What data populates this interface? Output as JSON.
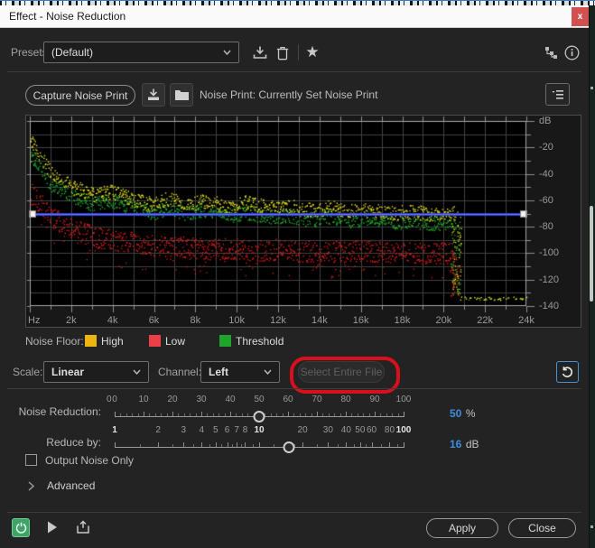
{
  "window": {
    "title": "Effect - Noise Reduction",
    "close_label": "x"
  },
  "presets": {
    "label": "Presets:",
    "value": "(Default)"
  },
  "noise_print": {
    "capture_button": "Capture Noise Print",
    "status_label": "Noise Print:",
    "status_value": "Currently Set Noise Print"
  },
  "chart_data": {
    "type": "scatter",
    "x_axis": {
      "tick_labels": [
        "Hz",
        "2k",
        "4k",
        "6k",
        "8k",
        "10k",
        "12k",
        "14k",
        "16k",
        "18k",
        "20k",
        "22k",
        "24k"
      ],
      "min_khz": 0,
      "max_khz": 24,
      "gridline_every_khz": 1
    },
    "y_axis": {
      "tick_labels": [
        "dB",
        "-20",
        "-40",
        "-60",
        "-80",
        "-100",
        "-120",
        "-140"
      ],
      "min_db": -140,
      "max_db": 0,
      "gridline_every_db": 10
    },
    "threshold_line": {
      "db": -70,
      "color": "#3040dd",
      "highlight": "#6a79ef",
      "handle_color": "#f2f2f2"
    },
    "grid_color": "#424242",
    "frame_color": "#a6a6a6",
    "plot_bg": "#000000",
    "series": [
      {
        "name": "Low",
        "color": "#e01d1d",
        "seed": 23,
        "spread_db": 16,
        "cutoff_khz": 20.45,
        "residual": {
          "db": -134,
          "density": 0
        },
        "envelope": [
          [
            0,
            -52
          ],
          [
            0.5,
            -60
          ],
          [
            1,
            -70
          ],
          [
            2,
            -79
          ],
          [
            3,
            -85
          ],
          [
            4,
            -88
          ],
          [
            5,
            -90
          ],
          [
            6,
            -92
          ],
          [
            7,
            -93
          ],
          [
            8,
            -94
          ],
          [
            9,
            -95
          ],
          [
            10,
            -94
          ],
          [
            11,
            -96
          ],
          [
            12,
            -95
          ],
          [
            13,
            -97
          ],
          [
            14,
            -96
          ],
          [
            15,
            -97
          ],
          [
            16,
            -96
          ],
          [
            17,
            -97
          ],
          [
            18,
            -97
          ],
          [
            19,
            -98
          ],
          [
            20.45,
            -98
          ]
        ]
      },
      {
        "name": "Threshold",
        "color": "#21b52d",
        "seed": 13,
        "spread_db": 11,
        "cutoff_khz": 20.5,
        "residual": {
          "db": -134,
          "density": 0.12
        },
        "envelope": [
          [
            0,
            -24
          ],
          [
            0.5,
            -33
          ],
          [
            1,
            -46
          ],
          [
            2,
            -55
          ],
          [
            3,
            -61
          ],
          [
            4,
            -59
          ],
          [
            5,
            -64
          ],
          [
            6,
            -68
          ],
          [
            6.7,
            -64
          ],
          [
            7.5,
            -68
          ],
          [
            8.5,
            -66
          ],
          [
            9.5,
            -70
          ],
          [
            10.5,
            -68
          ],
          [
            11.5,
            -71
          ],
          [
            12.5,
            -70
          ],
          [
            13.5,
            -73
          ],
          [
            14.5,
            -71
          ],
          [
            15.5,
            -74
          ],
          [
            16.5,
            -73
          ],
          [
            17.5,
            -75
          ],
          [
            18.5,
            -74
          ],
          [
            19.5,
            -76
          ],
          [
            20.5,
            -75
          ]
        ]
      },
      {
        "name": "High",
        "color": "#e6e31c",
        "seed": 7,
        "spread_db": 11,
        "cutoff_khz": 20.55,
        "residual": {
          "db": -134,
          "density": 0.5
        },
        "envelope": [
          [
            0,
            -13
          ],
          [
            0.4,
            -22
          ],
          [
            1,
            -38
          ],
          [
            2,
            -48
          ],
          [
            3,
            -54
          ],
          [
            4,
            -52
          ],
          [
            5,
            -58
          ],
          [
            6,
            -62
          ],
          [
            6.7,
            -57
          ],
          [
            7.5,
            -62
          ],
          [
            8.5,
            -59
          ],
          [
            9.5,
            -63
          ],
          [
            10.5,
            -60
          ],
          [
            11.5,
            -64
          ],
          [
            12.5,
            -63
          ],
          [
            13.5,
            -66
          ],
          [
            14.5,
            -64
          ],
          [
            15.5,
            -67
          ],
          [
            16.5,
            -66
          ],
          [
            17.5,
            -68
          ],
          [
            18.5,
            -67
          ],
          [
            19.5,
            -69
          ],
          [
            20.55,
            -68
          ]
        ]
      }
    ]
  },
  "legend": {
    "label": "Noise Floor:",
    "items": [
      {
        "label": "High",
        "color": "#ecb511"
      },
      {
        "label": "Low",
        "color": "#ee3e46"
      },
      {
        "label": "Threshold",
        "color": "#1ea52c"
      }
    ]
  },
  "controls": {
    "scale": {
      "label": "Scale:",
      "value": "Linear"
    },
    "channel": {
      "label": "Channel:",
      "value": "Left"
    },
    "select_entire_file": {
      "label": "Select Entire File",
      "enabled": false
    },
    "annotation_color": "#d8101d",
    "noise_reduction": {
      "label": "Noise Reduction:",
      "value": "50",
      "unit": "%",
      "scale": "linear",
      "min": 0,
      "max": 100,
      "edge_label": "0",
      "tick_labels": [
        "0",
        "10",
        "20",
        "30",
        "40",
        "50",
        "60",
        "70",
        "80",
        "90",
        "100"
      ],
      "tick_values": [
        0,
        10,
        20,
        30,
        40,
        50,
        60,
        70,
        80,
        90,
        100
      ],
      "emphasized": []
    },
    "reduce_by": {
      "label": "Reduce by:",
      "value": "16",
      "unit": "dB",
      "scale": "log",
      "min": 1,
      "max": 100,
      "edge_label": "",
      "tick_labels": [
        "1",
        "2",
        "3",
        "4",
        "5",
        "6",
        "7",
        "8",
        "10",
        "20",
        "30",
        "40",
        "50",
        "60",
        "80",
        "100"
      ],
      "tick_values": [
        1,
        2,
        3,
        4,
        5,
        6,
        7,
        8,
        10,
        20,
        30,
        40,
        50,
        60,
        80,
        100
      ],
      "emphasized": [
        "1",
        "10",
        "100"
      ]
    },
    "output_noise_only": "Output Noise Only",
    "advanced": "Advanced"
  },
  "footer": {
    "apply": "Apply",
    "close": "Close"
  },
  "colors": {
    "accent_blue": "#3e8edd",
    "power_green": "#3fa368",
    "close_red": "#d15151"
  }
}
